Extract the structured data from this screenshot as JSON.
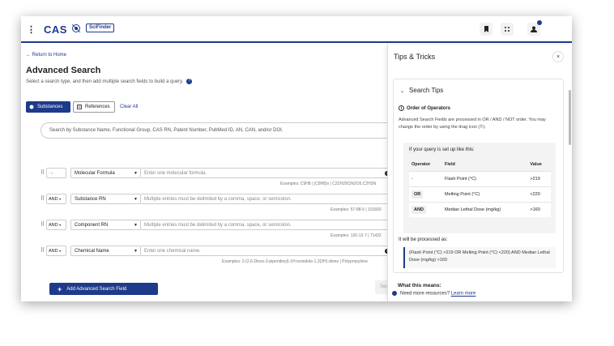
{
  "header": {
    "menu_glyph": "⋮",
    "logo": "CAS",
    "product": "SciFinder"
  },
  "main": {
    "return_link": "← Return to Home",
    "title": "Advanced Search",
    "subtitle": "Select a search type, and then add multiple search fields to build a query.",
    "tabs": [
      {
        "label": "Substances",
        "active": true
      },
      {
        "label": "References",
        "active": false
      }
    ],
    "clear_all": "Clear All",
    "search_placeholder": "Search by Substance Name, Functional Group, CAS RN, Patent Number, PubMed ID, AN, CAN, and/or DOI.",
    "rows": [
      {
        "operator": "-",
        "field": "Molecular Formula",
        "placeholder": "Enter one molecular formula.",
        "examples": "Examples: C9H8 | (C8H8)x | C22H29ClN2O5.C2H3N"
      },
      {
        "operator": "AND",
        "field": "Substance RN",
        "placeholder": "Multiple entries must be delimited by a comma, space, or semicolon.",
        "examples": "Examples: 57-88-5 | 101600"
      },
      {
        "operator": "AND",
        "field": "Component RN",
        "placeholder": "Multiple entries must be delimited by a comma, space, or semicolon.",
        "examples": "Examples: 120-12-7 | 71432"
      },
      {
        "operator": "AND",
        "field": "Chemical Name",
        "placeholder": "Enter one chemical name.",
        "examples": "Examples: 2-(2,6-Dioxo-3-piperidinyl)-1H-isoindole-1,3(2H)-dione | Polypropylene"
      }
    ],
    "add_field_button": "Add Advanced Search Field",
    "search_button": "Search"
  },
  "panel": {
    "title": "Tips & Tricks",
    "section": "Search Tips",
    "order_title": "Order of Operators",
    "order_text": "Advanced Search Fields are processed in OR / AND / NOT order. You may change the order by using the drag icon (⠿).",
    "example_title": "If your query is set up like this:",
    "table_headers": [
      "Operator",
      "Field",
      "Value"
    ],
    "table_rows": [
      {
        "operator": "-",
        "field": "Flash Point (°C)",
        "value": ">219"
      },
      {
        "operator": "OR",
        "field": "Melting Point (°C)",
        "value": "<220"
      },
      {
        "operator": "AND",
        "field": "Median Lethal Dose (mg/kg)",
        "value": ">160"
      }
    ],
    "processed_title": "It will be processed as:",
    "processed_text": "(Flash Point (°C) >219 OR Melting Point (°C) <220) AND Median Lethal Dose (mg/kg) >160",
    "what_means": "What this means:",
    "more_resources": "Need more resources?",
    "learn_more": "Learn more"
  },
  "colors": {
    "brand": "#1e3a8a"
  }
}
